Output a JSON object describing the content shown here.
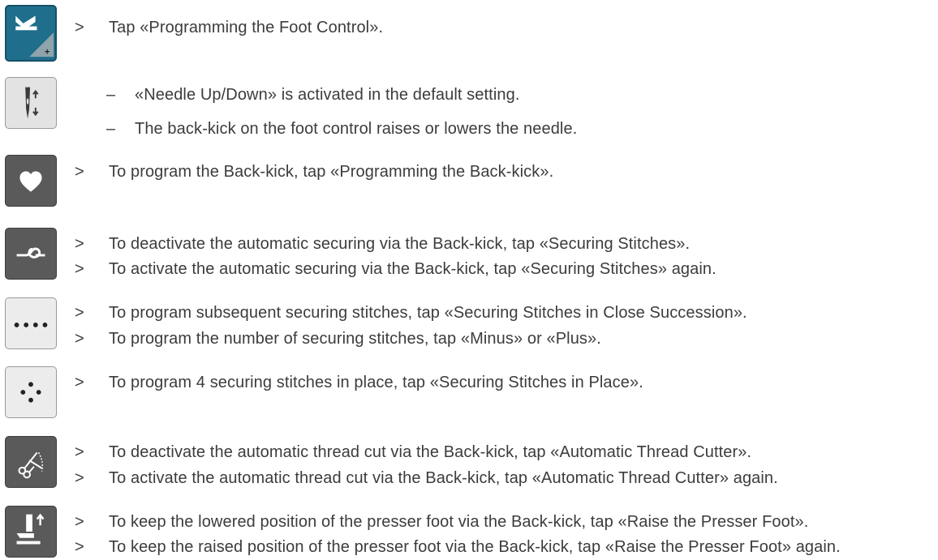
{
  "icons": [
    {
      "name": "programming-foot-control-icon",
      "bg": "#1f6e8c"
    },
    {
      "name": "needle-up-down-icon",
      "bg": "#e3e3e3"
    },
    {
      "name": "back-kick-heart-icon",
      "bg": "#5a5a5a"
    },
    {
      "name": "securing-stitches-icon",
      "bg": "#5a5a5a"
    },
    {
      "name": "securing-stitches-succession-icon",
      "bg": "#ececec"
    },
    {
      "name": "securing-stitches-in-place-icon",
      "bg": "#ececec"
    },
    {
      "name": "thread-cutter-icon",
      "bg": "#5a5a5a"
    },
    {
      "name": "raise-presser-foot-icon",
      "bg": "#5a5a5a"
    }
  ],
  "markers": {
    "step": ">",
    "note": "–"
  },
  "lines": [
    "Tap «Programming the Foot Control».",
    "«Needle Up/Down» is activated in the default setting.",
    "The back-kick on the foot control raises or lowers the needle.",
    "To program the Back-kick, tap «Programming the Back-kick».",
    "To deactivate the automatic securing via the Back-kick, tap «Securing Stitches».",
    "To activate the automatic securing via the Back-kick, tap «Securing Stitches» again.",
    "To program subsequent securing stitches, tap «Securing Stitches in Close Succession».",
    "To program the number of securing stitches, tap «Minus» or «Plus».",
    "To program 4 securing stitches in place, tap «Securing Stitches in Place».",
    "To deactivate the automatic thread cut via the Back-kick, tap «Automatic Thread Cutter».",
    "To activate the automatic thread cut via the Back-kick, tap «Automatic Thread Cutter» again.",
    "To keep the lowered position of the presser foot via the Back-kick, tap «Raise the Presser Foot».",
    "To keep the raised position of the presser foot via the Back-kick, tap «Raise the Presser Foot» again."
  ]
}
